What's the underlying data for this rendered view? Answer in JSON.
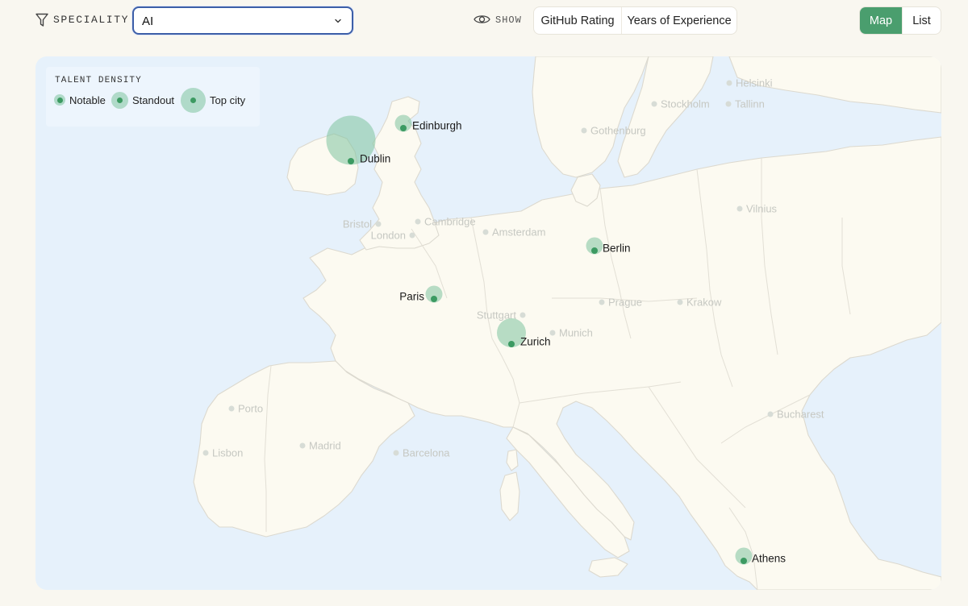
{
  "toolbar": {
    "speciality_label": "SPECIALITY",
    "speciality_value": "AI",
    "show_label": "SHOW",
    "sort_options": [
      "GitHub Rating",
      "Years of Experience"
    ],
    "view_options": [
      "Map",
      "List"
    ],
    "active_view": "Map"
  },
  "colors": {
    "accent": "#4a9e6e",
    "sea": "#e6f1fb",
    "land": "#fcfaf1",
    "border": "#dcd9cf",
    "marker": "#3c9a62",
    "halo": "#a7d4bb",
    "select_border": "#3d5fa8"
  },
  "legend": {
    "title": "TALENT DENSITY",
    "items": [
      {
        "label": "Notable",
        "tier": "notable"
      },
      {
        "label": "Standout",
        "tier": "standout"
      },
      {
        "label": "Top city",
        "tier": "top"
      }
    ]
  },
  "cities": [
    {
      "name": "Edinburgh",
      "tier": "standout"
    },
    {
      "name": "Dublin",
      "tier": "top"
    },
    {
      "name": "Berlin",
      "tier": "standout"
    },
    {
      "name": "Paris",
      "tier": "standout"
    },
    {
      "name": "Zurich",
      "tier": "top"
    },
    {
      "name": "Athens",
      "tier": "standout"
    }
  ],
  "faded_cities": [
    "Helsinki",
    "Stockholm",
    "Tallinn",
    "Gothenburg",
    "Vilnius",
    "Cambridge",
    "Bristol",
    "London",
    "Amsterdam",
    "Prague",
    "Krakow",
    "Stuttgart",
    "Munich",
    "Porto",
    "Madrid",
    "Lisbon",
    "Barcelona",
    "Bucharest"
  ]
}
